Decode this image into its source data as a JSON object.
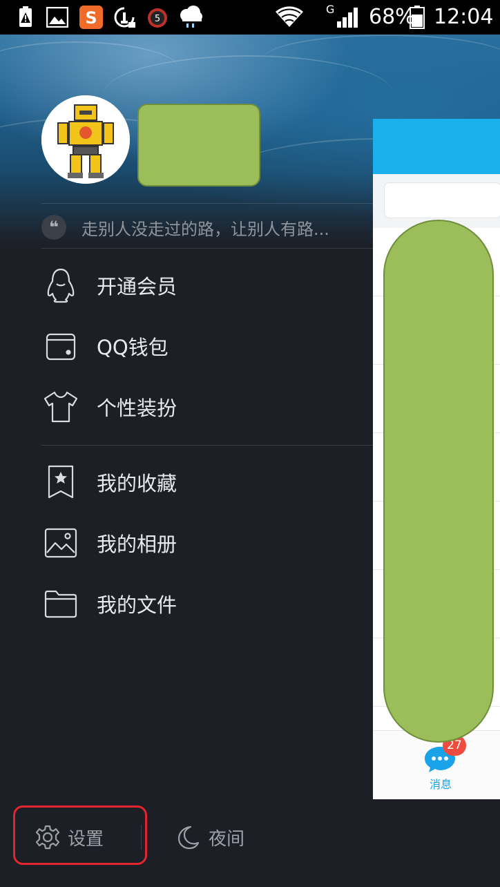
{
  "status_bar": {
    "battery_percent": "68%",
    "time": "12:04",
    "network_type": "G",
    "alarm_badge": "5",
    "icons": [
      "warning-battery-icon",
      "gallery-icon",
      "sogou-input-icon",
      "cleaner-icon",
      "alarm-icon",
      "weather-rain-icon",
      "wifi-icon",
      "signal-icon",
      "battery-icon"
    ]
  },
  "profile": {
    "signature": "走别人没走过的路，让别人有路..."
  },
  "menu": {
    "group1": [
      {
        "label": "开通会员",
        "icon": "penguin-icon"
      },
      {
        "label": "QQ钱包",
        "icon": "wallet-icon"
      },
      {
        "label": "个性装扮",
        "icon": "tshirt-icon"
      }
    ],
    "group2": [
      {
        "label": "我的收藏",
        "icon": "bookmark-star-icon"
      },
      {
        "label": "我的相册",
        "icon": "photo-album-icon"
      },
      {
        "label": "我的文件",
        "icon": "folder-icon"
      }
    ]
  },
  "bottom": {
    "settings_label": "设置",
    "night_label": "夜间"
  },
  "peek_panel": {
    "tab_label": "消息",
    "unread_badge": "27"
  },
  "colors": {
    "drawer_bg": "#1c1f26",
    "accent_blue": "#1ab0ee",
    "badge_red": "#ef4b3f",
    "highlight_red": "#e3262e",
    "redaction_green": "#9bbd5a"
  }
}
